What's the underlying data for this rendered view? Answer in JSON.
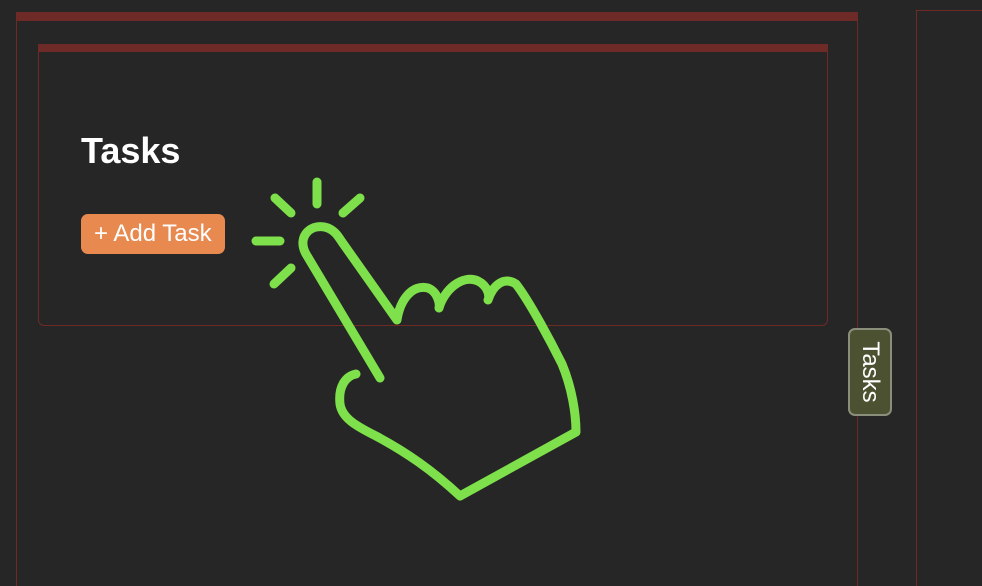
{
  "card": {
    "title": "Tasks",
    "add_button_label": "+ Add Task"
  },
  "side_tab": {
    "label": "Tasks"
  },
  "colors": {
    "background": "#262626",
    "border": "#6e2a26",
    "accent_button": "#e8894f",
    "tab_background": "#4c5131",
    "pointer_hand": "#7ee04a"
  },
  "icons": {
    "pointer": "tap-hand-icon"
  }
}
